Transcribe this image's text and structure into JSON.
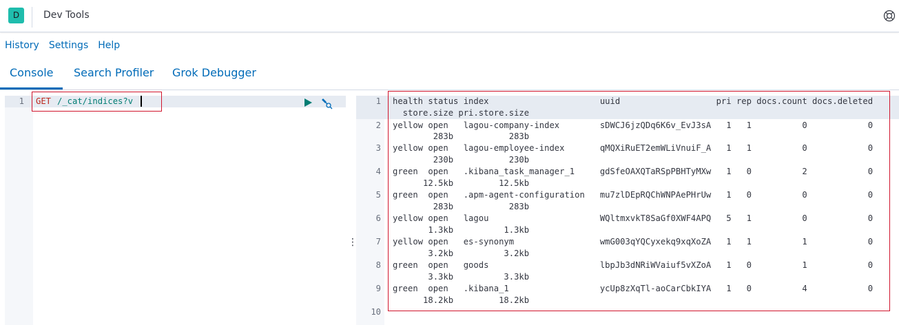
{
  "header": {
    "logo_letter": "D",
    "title": "Dev Tools",
    "help_icon": "help-circle-icon"
  },
  "links": [
    "History",
    "Settings",
    "Help"
  ],
  "tabs": [
    {
      "label": "Console",
      "active": true
    },
    {
      "label": "Search Profiler",
      "active": false
    },
    {
      "label": "Grok Debugger",
      "active": false
    }
  ],
  "request": {
    "line_number": "1",
    "method": "GET",
    "path": "/_cat/indices?v"
  },
  "actions": {
    "run_icon": "play-icon",
    "settings_icon": "wrench-icon"
  },
  "output": {
    "lines": [
      {
        "n": "1",
        "rows": [
          "health status index                      uuid                   pri rep docs.count docs.deleted",
          "  store.size pri.store.size"
        ]
      },
      {
        "n": "2",
        "rows": [
          "yellow open   lagou-company-index        sDWCJ6jzQDq6K6v_EvJ3sA   1   1          0            0",
          "        283b           283b"
        ]
      },
      {
        "n": "3",
        "rows": [
          "yellow open   lagou-employee-index       qMQXiRuET2emWLiVnuiF_A   1   1          0            0",
          "        230b           230b"
        ]
      },
      {
        "n": "4",
        "rows": [
          "green  open   .kibana_task_manager_1     gdSfeOAXQTaRSpPBHTyMXw   1   0          2            0",
          "      12.5kb         12.5kb"
        ]
      },
      {
        "n": "5",
        "rows": [
          "green  open   .apm-agent-configuration   mu7zlDEpRQChWNPAePHrUw   1   0          0            0",
          "        283b           283b"
        ]
      },
      {
        "n": "6",
        "rows": [
          "yellow open   lagou                      WQltmxvkT8SaGf0XWF4APQ   5   1          0            0",
          "       1.3kb          1.3kb"
        ]
      },
      {
        "n": "7",
        "rows": [
          "yellow open   es-synonym                 wmG003qYQCyxekq9xqXoZA   1   1          1            0",
          "       3.2kb          3.2kb"
        ]
      },
      {
        "n": "8",
        "rows": [
          "green  open   goods                      lbpJb3dNRiWVaiuf5vXZoA   1   0          1            0",
          "       3.3kb          3.3kb"
        ]
      },
      {
        "n": "9",
        "rows": [
          "green  open   .kibana_1                  ycUp8zXqTl-aoCarCbkIYA   1   0          4            0",
          "      18.2kb         18.2kb"
        ]
      },
      {
        "n": "10",
        "rows": []
      }
    ]
  }
}
